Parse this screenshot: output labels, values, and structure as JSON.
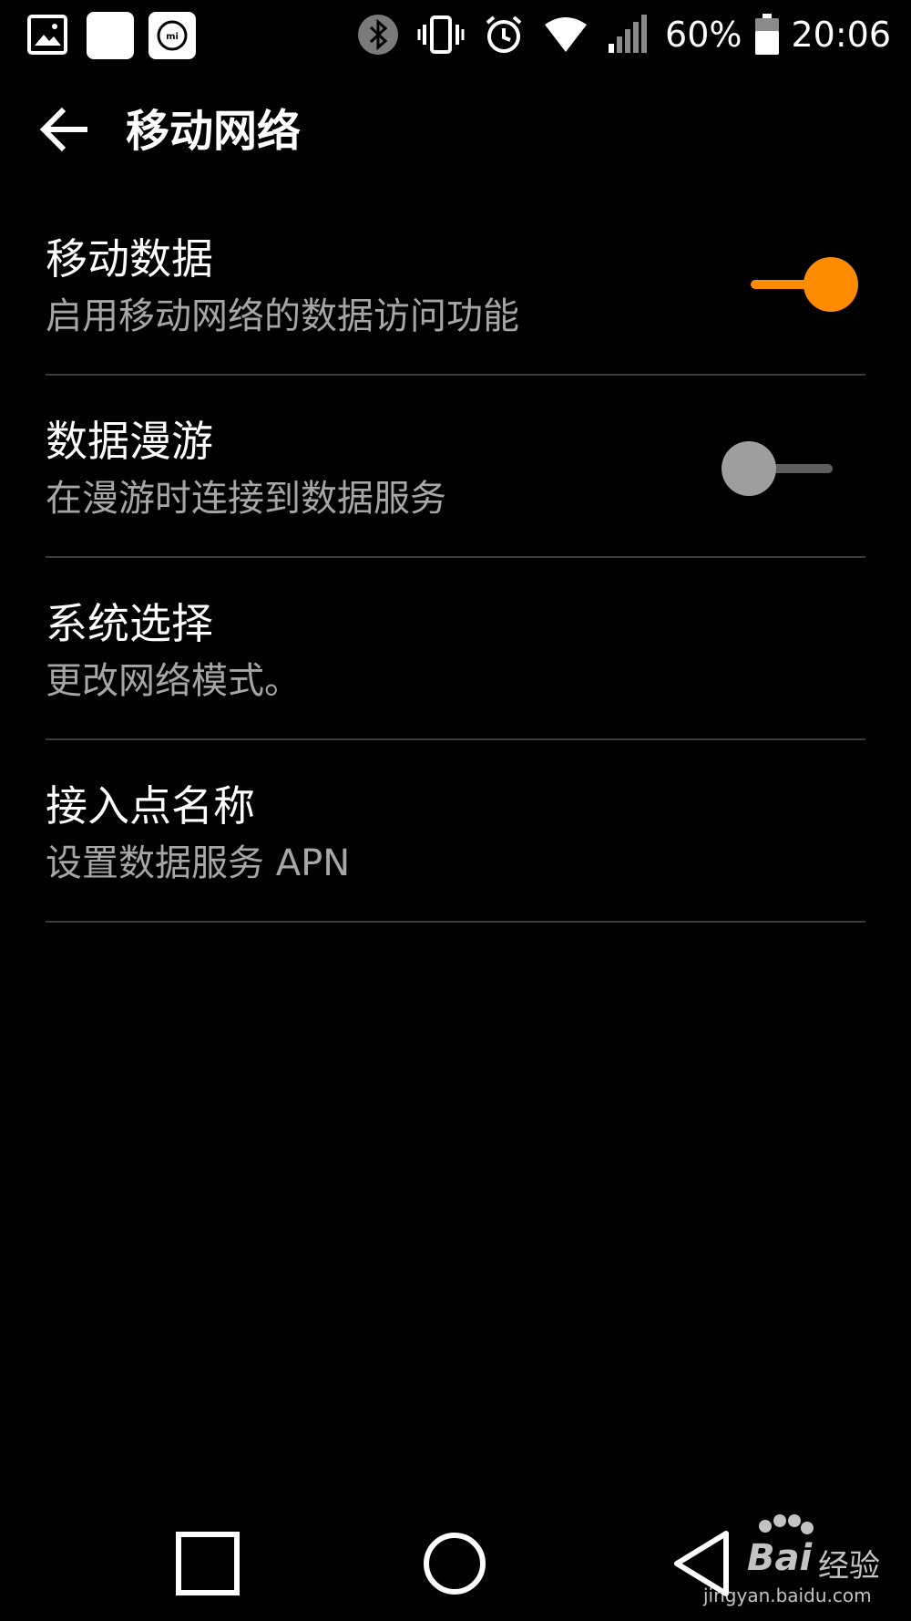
{
  "status_bar": {
    "battery_percent": "60%",
    "time": "20:06",
    "left_icons": [
      "gallery-icon",
      "blank-notification-icon",
      "mi-icon"
    ],
    "right_icons": [
      "bluetooth-icon",
      "vibrate-icon",
      "alarm-icon",
      "wifi-icon",
      "cell-signal-icon",
      "battery-icon"
    ]
  },
  "app_bar": {
    "title": "移动网络"
  },
  "settings": [
    {
      "title": "移动数据",
      "summary": "启用移动网络的数据访问功能",
      "switch": "on"
    },
    {
      "title": "数据漫游",
      "summary": "在漫游时连接到数据服务",
      "switch": "off"
    },
    {
      "title": "系统选择",
      "summary": "更改网络模式。"
    },
    {
      "title": "接入点名称",
      "summary": "设置数据服务 APN"
    }
  ],
  "nav_bar": {
    "buttons": [
      "recents-icon",
      "home-icon",
      "back-icon"
    ]
  },
  "watermark": {
    "brand": "Bai",
    "brand_suffix": "经验",
    "url": "jingyan.baidu.com"
  },
  "colors": {
    "background": "#000000",
    "accent": "#ff8c00",
    "text_primary": "#ffffff",
    "text_secondary": "#a6a6a6",
    "divider": "#3a3a3a"
  }
}
